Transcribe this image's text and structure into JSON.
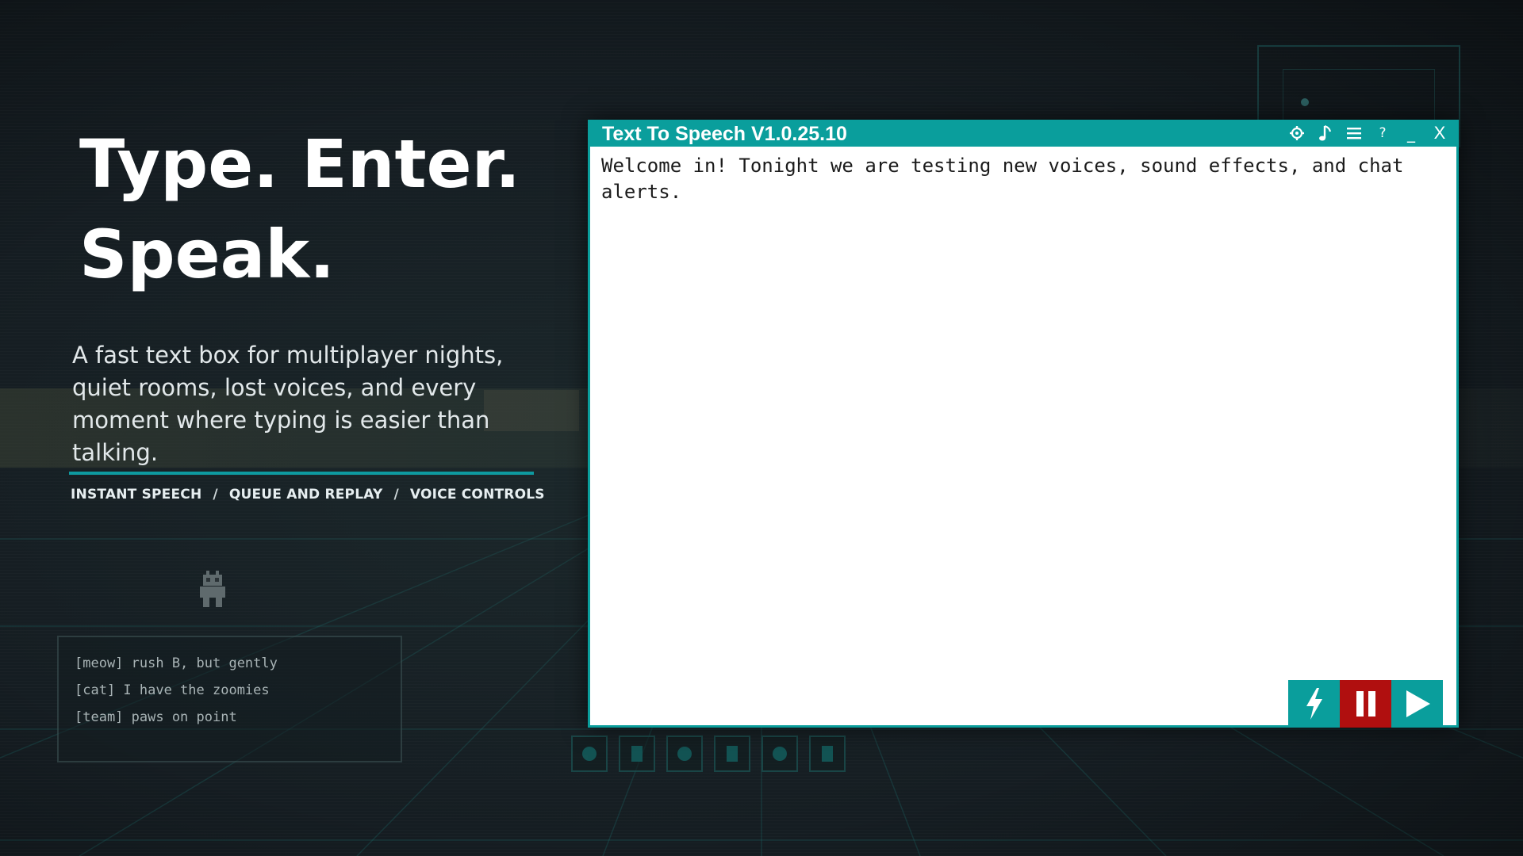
{
  "hero": {
    "title_line1": "Type. Enter.",
    "title_line2": "Speak.",
    "subtitle": "A fast text box for multiplayer nights, quiet rooms, lost voices, and every moment where typing is easier than talking."
  },
  "features": {
    "items": [
      "INSTANT SPEECH",
      "QUEUE AND REPLAY",
      "VOICE CONTROLS"
    ],
    "separator": "/"
  },
  "chat_preview": {
    "lines": [
      "[meow] rush B, but gently",
      "[cat] I have the zoomies",
      "[team] paws on point"
    ]
  },
  "app": {
    "title": "Text To Speech V1.0.25.10",
    "title_controls": {
      "settings_icon": "gear-icon",
      "sound_icon": "music-note-icon",
      "menu_icon": "hamburger-menu-icon",
      "help_label": "?",
      "minimize_label": "_",
      "close_label": "X"
    },
    "editor_text": "Welcome in! Tonight we are testing new voices, sound effects, and chat alerts.",
    "actions": {
      "instant_icon": "lightning-icon",
      "pause_icon": "pause-icon",
      "play_icon": "play-icon"
    }
  },
  "colors": {
    "accent": "#0a9e9c",
    "pause_red": "#b00f0f",
    "background": "#151d22",
    "editor_bg": "#ffffff"
  }
}
